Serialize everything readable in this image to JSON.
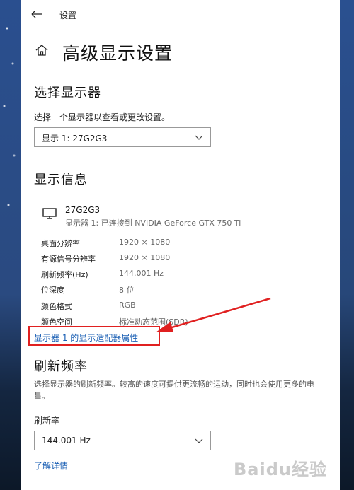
{
  "window": {
    "title": "设置"
  },
  "page": {
    "title": "高级显示设置"
  },
  "select_display": {
    "heading": "选择显示器",
    "instruction": "选择一个显示器以查看或更改设置。",
    "selected": "显示 1: 27G2G3"
  },
  "display_info": {
    "heading": "显示信息",
    "monitor_name": "27G2G3",
    "monitor_connection": "显示器 1: 已连接到 NVIDIA GeForce GTX 750 Ti",
    "rows": [
      {
        "key": "桌面分辨率",
        "value": "1920 × 1080"
      },
      {
        "key": "有源信号分辨率",
        "value": "1920 × 1080"
      },
      {
        "key": "刷新频率(Hz)",
        "value": "144.001 Hz"
      },
      {
        "key": "位深度",
        "value": "8 位"
      },
      {
        "key": "颜色格式",
        "value": "RGB"
      },
      {
        "key": "颜色空间",
        "value": "标准动态范围(SDR)"
      }
    ],
    "adapter_link": "显示器 1 的显示适配器属性"
  },
  "refresh": {
    "heading": "刷新频率",
    "description": "选择显示器的刷新频率。较高的速度可提供更流畅的运动，同时也会使用更多的电量。",
    "label": "刷新率",
    "selected": "144.001 Hz",
    "learn_more": "了解详情"
  },
  "watermark": "Baidu经验",
  "colors": {
    "link": "#1a5fb4",
    "annotation": "#e02020"
  }
}
